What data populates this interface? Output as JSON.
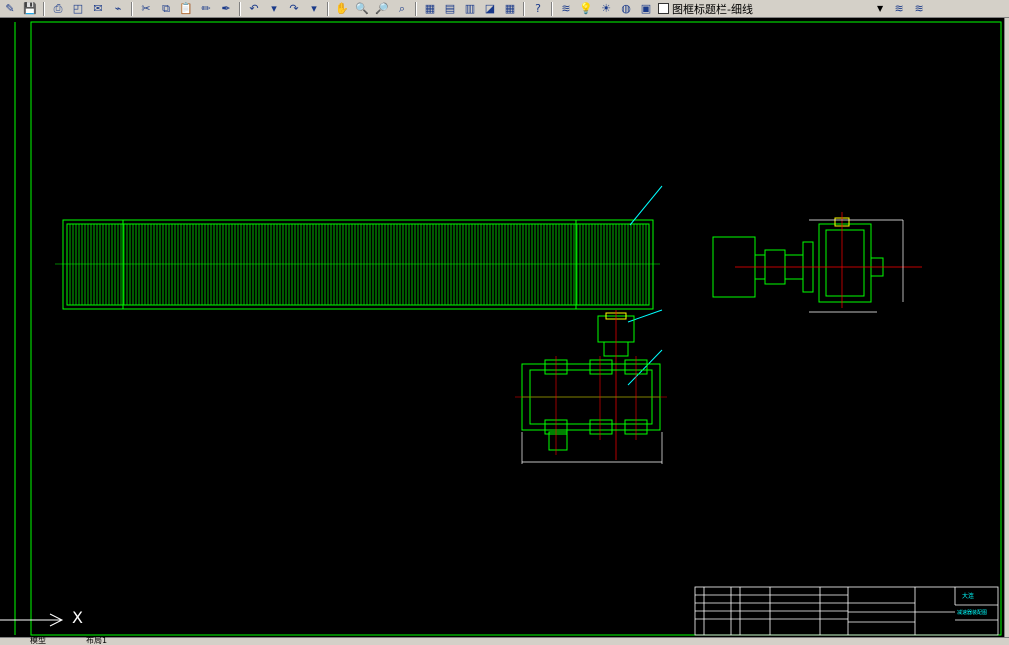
{
  "toolbar": {
    "buttons": [
      {
        "name": "new-icon",
        "glyph": "✎"
      },
      {
        "name": "save-icon",
        "glyph": "💾"
      },
      {
        "name": "print-icon",
        "glyph": "⎙"
      },
      {
        "name": "print-preview-icon",
        "glyph": "◰"
      },
      {
        "name": "publish-icon",
        "glyph": "✉"
      },
      {
        "name": "plot-icon",
        "glyph": "⌁"
      },
      {
        "name": "cut-icon",
        "glyph": "✂"
      },
      {
        "name": "copy-icon",
        "glyph": "⧉"
      },
      {
        "name": "paste-icon",
        "glyph": "📋"
      },
      {
        "name": "match-properties-icon",
        "glyph": "✏"
      },
      {
        "name": "block-editor-icon",
        "glyph": "✒"
      },
      {
        "name": "undo-icon",
        "glyph": "↶"
      },
      {
        "name": "undo-dropdown-icon",
        "glyph": "▾"
      },
      {
        "name": "redo-icon",
        "glyph": "↷"
      },
      {
        "name": "redo-dropdown-icon",
        "glyph": "▾"
      },
      {
        "name": "pan-icon",
        "glyph": "✋"
      },
      {
        "name": "zoom-realtime-icon",
        "glyph": "🔍"
      },
      {
        "name": "zoom-window-icon",
        "glyph": "🔎"
      },
      {
        "name": "zoom-previous-icon",
        "glyph": "⌕"
      },
      {
        "name": "properties-icon",
        "glyph": "▦"
      },
      {
        "name": "design-center-icon",
        "glyph": "▤"
      },
      {
        "name": "tool-palettes-icon",
        "glyph": "▥"
      },
      {
        "name": "markup-icon",
        "glyph": "◪"
      },
      {
        "name": "calculator-icon",
        "glyph": "▦"
      },
      {
        "name": "help-icon",
        "glyph": "?"
      }
    ],
    "layer_buttons": [
      {
        "name": "layer-properties-icon",
        "glyph": "≋"
      },
      {
        "name": "layer-on-icon",
        "glyph": "💡"
      },
      {
        "name": "layer-freeze-icon",
        "glyph": "☀"
      },
      {
        "name": "layer-lock-icon",
        "glyph": "◍"
      },
      {
        "name": "layer-color-icon",
        "glyph": "▣"
      }
    ],
    "layer_name": "图框标题栏-细线",
    "right_buttons": [
      {
        "name": "layer-previous-icon",
        "glyph": "≋"
      },
      {
        "name": "layer-states-icon",
        "glyph": "≋"
      }
    ]
  },
  "status": {
    "tab_model": "模型",
    "tab_layout": "布局1"
  },
  "colors": {
    "background": "#000000",
    "toolbar": "#d4d0c8",
    "green": "#00ff00",
    "red": "#ff0000",
    "cyan": "#00ffff",
    "white": "#ffffff",
    "yellow": "#ffff00"
  },
  "drawing": {
    "ucs_x_label": "X",
    "title_block_texts": [
      "大连",
      "减速器装配图"
    ]
  }
}
